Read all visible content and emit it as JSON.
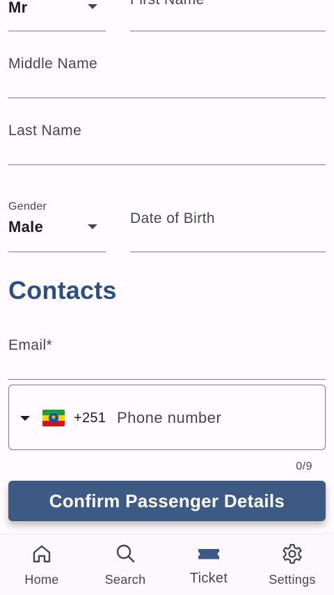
{
  "form": {
    "title_field": {
      "value": "Mr"
    },
    "first_name": {
      "label": "First Name"
    },
    "middle_name": {
      "label": "Middle Name"
    },
    "last_name": {
      "label": "Last Name"
    },
    "gender": {
      "label": "Gender",
      "value": "Male"
    },
    "date_of_birth": {
      "label": "Date of Birth"
    }
  },
  "contacts": {
    "section_title": "Contacts",
    "email": {
      "label": "Email*"
    },
    "phone": {
      "country_flag": "ethiopia-flag",
      "dial_code": "+251",
      "placeholder": "Phone number",
      "counter": "0/9"
    }
  },
  "actions": {
    "confirm_label": "Confirm Passenger Details"
  },
  "bottom_nav": {
    "items": [
      {
        "label": "Home",
        "icon": "home-icon"
      },
      {
        "label": "Search",
        "icon": "search-icon"
      },
      {
        "label": "Ticket",
        "icon": "ticket-icon",
        "active": true
      },
      {
        "label": "Settings",
        "icon": "gear-icon"
      }
    ]
  },
  "colors": {
    "primary": "#3d5a85",
    "section_title": "#2d5080",
    "background": "#fffbfe"
  }
}
